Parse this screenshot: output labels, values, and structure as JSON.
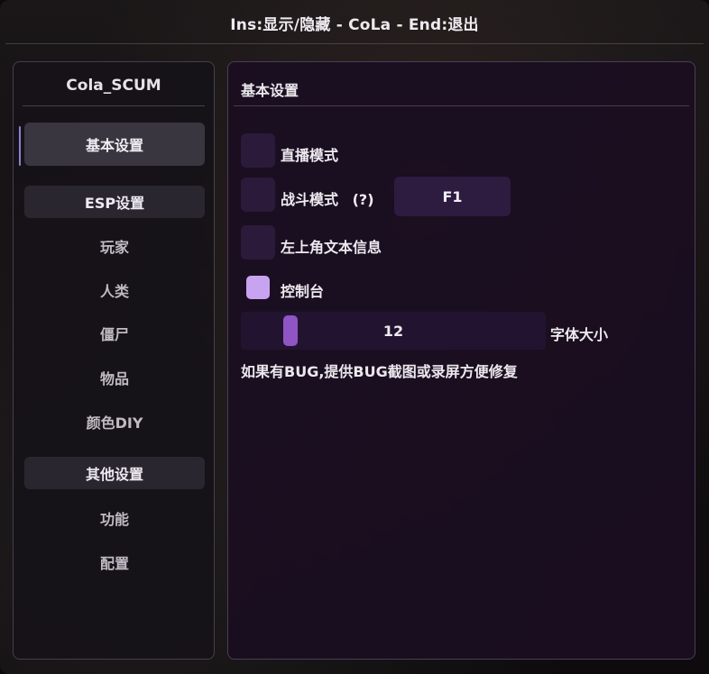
{
  "window": {
    "title": "Ins:显示/隐藏 - CoLa - End:退出"
  },
  "sidebar": {
    "title": "Cola_SCUM",
    "items": [
      {
        "label": "基本设置",
        "kind": "item",
        "active": true
      },
      {
        "label": "ESP设置",
        "kind": "header"
      },
      {
        "label": "玩家",
        "kind": "sub"
      },
      {
        "label": "人类",
        "kind": "sub"
      },
      {
        "label": "僵尸",
        "kind": "sub"
      },
      {
        "label": "物品",
        "kind": "sub"
      },
      {
        "label": "颜色DIY",
        "kind": "sub"
      },
      {
        "label": "其他设置",
        "kind": "header"
      },
      {
        "label": "功能",
        "kind": "sub"
      },
      {
        "label": "配置",
        "kind": "sub"
      }
    ]
  },
  "content": {
    "title": "基本设置",
    "options": {
      "stream_mode": {
        "label": "直播模式",
        "checked": false
      },
      "combat_mode": {
        "label": "战斗模式",
        "help": "(?)",
        "checked": false,
        "hotkey": "F1"
      },
      "top_left_info": {
        "label": "左上角文本信息",
        "checked": false
      },
      "console": {
        "label": "控制台",
        "checked": true
      }
    },
    "font_size": {
      "label": "字体大小",
      "value": "12",
      "fraction": 0.05
    },
    "note": "如果有BUG,提供BUG截图或录屏方便修复"
  },
  "colors": {
    "accent": "#8f7fd6",
    "checkbox_checked": "#c8a3f0",
    "slider_thumb": "#8f55c4"
  }
}
